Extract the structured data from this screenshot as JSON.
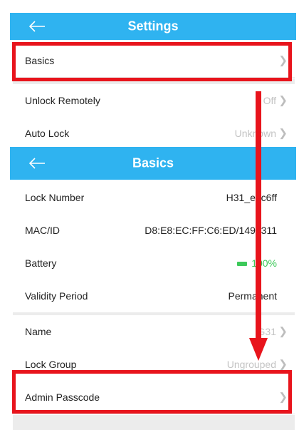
{
  "settings_header": {
    "title": "Settings"
  },
  "settings_items": [
    {
      "label": "Basics",
      "value": ""
    },
    {
      "label": "Unlock Remotely",
      "value": "Off"
    },
    {
      "label": "Auto Lock",
      "value": "Unknown"
    }
  ],
  "basics_header": {
    "title": "Basics"
  },
  "basics_info": [
    {
      "label": "Lock Number",
      "value": "H31_ebc6ff"
    },
    {
      "label": "MAC/ID",
      "value": "D8:E8:EC:FF:C6:ED/1492311"
    },
    {
      "label": "Battery",
      "value": "100%"
    },
    {
      "label": "Validity Period",
      "value": "Permanent"
    }
  ],
  "basics_settings": [
    {
      "label": "Name",
      "value": "G31"
    },
    {
      "label": "Lock Group",
      "value": "Ungrouped"
    },
    {
      "label": "Admin Passcode",
      "value": ""
    }
  ],
  "colors": {
    "header": "#2fb3f0",
    "highlight": "#e8141c",
    "battery": "#3dc95a"
  },
  "icons": {
    "back": "arrow-left-icon",
    "chevron": "chevron-right-icon"
  }
}
